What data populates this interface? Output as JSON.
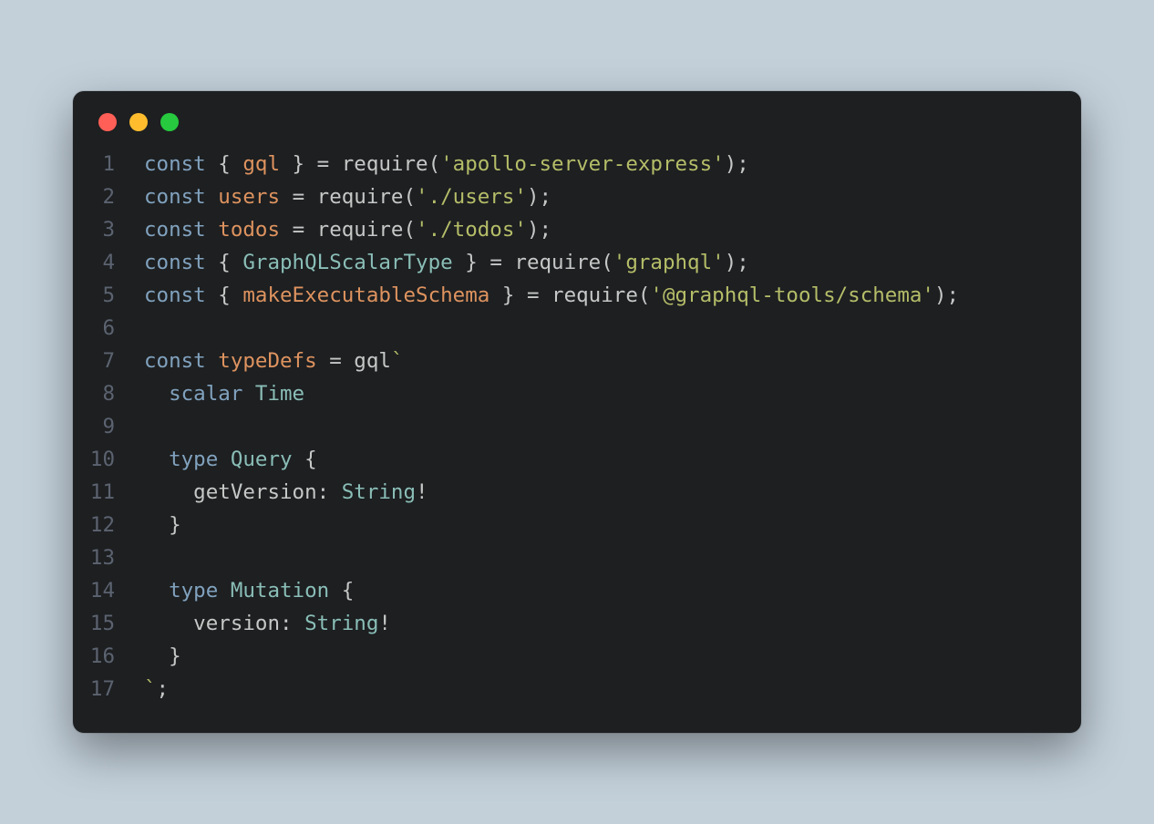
{
  "window": {
    "traffic_lights": [
      "close",
      "minimize",
      "maximize"
    ]
  },
  "code": {
    "language": "javascript",
    "lines": [
      {
        "n": "1",
        "tokens": [
          {
            "t": "const ",
            "c": "kw"
          },
          {
            "t": "{ ",
            "c": "punc"
          },
          {
            "t": "gql",
            "c": "prop"
          },
          {
            "t": " } ",
            "c": "punc"
          },
          {
            "t": "=",
            "c": "op"
          },
          {
            "t": " require(",
            "c": "func"
          },
          {
            "t": "'apollo-server-express'",
            "c": "str"
          },
          {
            "t": ");",
            "c": "punc"
          }
        ]
      },
      {
        "n": "2",
        "tokens": [
          {
            "t": "const ",
            "c": "kw"
          },
          {
            "t": "users",
            "c": "prop"
          },
          {
            "t": " ",
            "c": "punc"
          },
          {
            "t": "=",
            "c": "op"
          },
          {
            "t": " require(",
            "c": "func"
          },
          {
            "t": "'./users'",
            "c": "str"
          },
          {
            "t": ");",
            "c": "punc"
          }
        ]
      },
      {
        "n": "3",
        "tokens": [
          {
            "t": "const ",
            "c": "kw"
          },
          {
            "t": "todos",
            "c": "prop"
          },
          {
            "t": " ",
            "c": "punc"
          },
          {
            "t": "=",
            "c": "op"
          },
          {
            "t": " require(",
            "c": "func"
          },
          {
            "t": "'./todos'",
            "c": "str"
          },
          {
            "t": ");",
            "c": "punc"
          }
        ]
      },
      {
        "n": "4",
        "tokens": [
          {
            "t": "const ",
            "c": "kw"
          },
          {
            "t": "{ ",
            "c": "punc"
          },
          {
            "t": "GraphQLScalarType",
            "c": "type"
          },
          {
            "t": " } ",
            "c": "punc"
          },
          {
            "t": "=",
            "c": "op"
          },
          {
            "t": " require(",
            "c": "func"
          },
          {
            "t": "'graphql'",
            "c": "str"
          },
          {
            "t": ");",
            "c": "punc"
          }
        ]
      },
      {
        "n": "5",
        "tokens": [
          {
            "t": "const ",
            "c": "kw"
          },
          {
            "t": "{ ",
            "c": "punc"
          },
          {
            "t": "makeExecutableSchema",
            "c": "prop"
          },
          {
            "t": " } ",
            "c": "punc"
          },
          {
            "t": "=",
            "c": "op"
          },
          {
            "t": " require(",
            "c": "func"
          },
          {
            "t": "'@graphql-tools/schema'",
            "c": "str"
          },
          {
            "t": ");",
            "c": "punc"
          }
        ]
      },
      {
        "n": "6",
        "tokens": []
      },
      {
        "n": "7",
        "tokens": [
          {
            "t": "const ",
            "c": "kw"
          },
          {
            "t": "typeDefs",
            "c": "prop"
          },
          {
            "t": " ",
            "c": "punc"
          },
          {
            "t": "=",
            "c": "op"
          },
          {
            "t": " gql",
            "c": "func"
          },
          {
            "t": "`",
            "c": "str"
          }
        ]
      },
      {
        "n": "8",
        "tokens": [
          {
            "t": "  ",
            "c": "punc"
          },
          {
            "t": "scalar ",
            "c": "kw"
          },
          {
            "t": "Time",
            "c": "type"
          }
        ]
      },
      {
        "n": "9",
        "tokens": []
      },
      {
        "n": "10",
        "tokens": [
          {
            "t": "  ",
            "c": "punc"
          },
          {
            "t": "type ",
            "c": "kw"
          },
          {
            "t": "Query",
            "c": "type"
          },
          {
            "t": " {",
            "c": "punc"
          }
        ]
      },
      {
        "n": "11",
        "tokens": [
          {
            "t": "    getVersion",
            "c": "field"
          },
          {
            "t": ": ",
            "c": "punc"
          },
          {
            "t": "String",
            "c": "type"
          },
          {
            "t": "!",
            "c": "punc"
          }
        ]
      },
      {
        "n": "12",
        "tokens": [
          {
            "t": "  }",
            "c": "punc"
          }
        ]
      },
      {
        "n": "13",
        "tokens": []
      },
      {
        "n": "14",
        "tokens": [
          {
            "t": "  ",
            "c": "punc"
          },
          {
            "t": "type ",
            "c": "kw"
          },
          {
            "t": "Mutation",
            "c": "type"
          },
          {
            "t": " {",
            "c": "punc"
          }
        ]
      },
      {
        "n": "15",
        "tokens": [
          {
            "t": "    version",
            "c": "field"
          },
          {
            "t": ": ",
            "c": "punc"
          },
          {
            "t": "String",
            "c": "type"
          },
          {
            "t": "!",
            "c": "punc"
          }
        ]
      },
      {
        "n": "16",
        "tokens": [
          {
            "t": "  }",
            "c": "punc"
          }
        ]
      },
      {
        "n": "17",
        "tokens": [
          {
            "t": "`",
            "c": "str"
          },
          {
            "t": ";",
            "c": "punc"
          }
        ]
      }
    ]
  }
}
